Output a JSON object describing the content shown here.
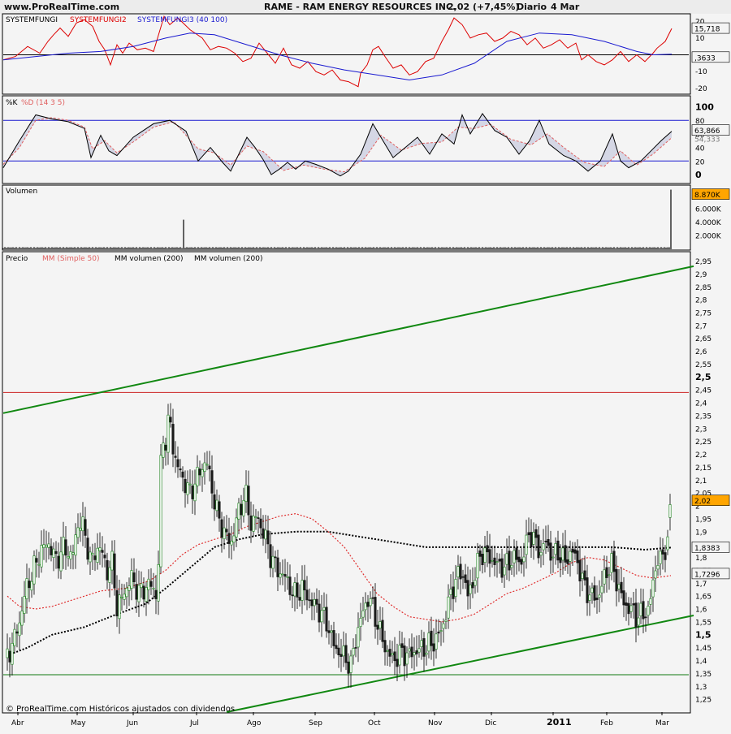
{
  "header": {
    "site": "www.ProRealTime.com",
    "title": "RAME - RAM ENERGY RESOURCES INC.",
    "quote": "2,02 (+7,45%)",
    "period": "Diario",
    "date": "4 Mar"
  },
  "footer": {
    "copyright": "© ProRealTime.com Históricos ajustados con dividendos"
  },
  "colors": {
    "background": "#f4f4f4",
    "price_up": "#2e8b2e",
    "price_down": "#1a1a1a",
    "sma50": "#e03030",
    "vol_ma": "#000000",
    "trendline": "#118811",
    "resistance": "#cc2222",
    "support": "#117711",
    "osc_red": "#dd0000",
    "osc_blue": "#1a1ad0",
    "stoch_k": "#000000",
    "stoch_d": "#e06060",
    "highlight_value": "#ffa500"
  },
  "chart_data": [
    {
      "id": "systemfungi",
      "type": "line",
      "legend": [
        "SYSTEMFUNGI",
        "SYSTEMFUNGI2",
        "SYSTEMFUNGI3 (40 100)"
      ],
      "ylim": [
        -23,
        24
      ],
      "yticks": [
        20,
        10,
        0,
        -10,
        -20
      ],
      "last_values": {
        "red": 15.718,
        "blue": 0.3633
      },
      "last_labels": [
        "15,718",
        ",3633"
      ],
      "zero_label": "0",
      "series": [
        {
          "name": "SYSTEMFUNGI2",
          "color": "#dd0000",
          "x": [
            0,
            15,
            30,
            45,
            55,
            62,
            70,
            80,
            90,
            100,
            110,
            118,
            125,
            132,
            140,
            147,
            155,
            165,
            175,
            185,
            190,
            198,
            205,
            215,
            230,
            245,
            255,
            265,
            275,
            285,
            295,
            305,
            315,
            325,
            335,
            345,
            355,
            365,
            375,
            385,
            395,
            405,
            415,
            425,
            437,
            440,
            448,
            455,
            462,
            470,
            480,
            490,
            500,
            510,
            520,
            530,
            540,
            548,
            555,
            565,
            575,
            585,
            595,
            605,
            615,
            625,
            635,
            645,
            655,
            665,
            675,
            685,
            695,
            705,
            712,
            720,
            730,
            740,
            750,
            760,
            770,
            780,
            790,
            800,
            805,
            815,
            823
          ],
          "y": [
            -3,
            -1,
            5,
            1,
            8,
            12,
            16,
            11,
            19,
            21,
            17,
            8,
            3,
            -6,
            6,
            1,
            7,
            3,
            4,
            2,
            10,
            23,
            18,
            22,
            15,
            10,
            3,
            5,
            4,
            1,
            -4,
            -2,
            7,
            1,
            -5,
            4,
            -6,
            -8,
            -4,
            -10,
            -12,
            -9,
            -15,
            -16,
            -19,
            -11,
            -6,
            3,
            5,
            -1,
            -8,
            -6,
            -12,
            -10,
            -4,
            -2,
            8,
            15,
            22,
            18,
            10,
            12,
            13,
            8,
            10,
            14,
            12,
            6,
            10,
            4,
            6,
            9,
            4,
            7,
            -3,
            0,
            -4,
            -6,
            -3,
            2,
            -4,
            0,
            -4,
            1,
            4,
            8,
            15.718
          ]
        },
        {
          "name": "SYSTEMFUNGI3 (40 100)",
          "color": "#1a1ad0",
          "x": [
            0,
            40,
            80,
            120,
            160,
            200,
            230,
            260,
            300,
            340,
            380,
            420,
            460,
            500,
            540,
            580,
            620,
            660,
            700,
            740,
            780,
            800,
            823
          ],
          "y": [
            -3,
            -1,
            1,
            2,
            5,
            10,
            13,
            12,
            6,
            0,
            -5,
            -9,
            -12,
            -15,
            -12,
            -5,
            8,
            13,
            12,
            8,
            2,
            0,
            0.3633
          ]
        }
      ]
    },
    {
      "id": "stochastic",
      "type": "line",
      "legend": [
        "%K",
        "%D (14 3 5)"
      ],
      "ylim": [
        -12,
        115
      ],
      "yticks": [
        100,
        80,
        60,
        40,
        20,
        0
      ],
      "levels": [
        80,
        20
      ],
      "last_values": {
        "k": 63.866,
        "d": 54.333
      },
      "last_labels": [
        "63,866",
        "54,333"
      ],
      "series": [
        {
          "name": "%K",
          "color": "#000000",
          "x": [
            0,
            20,
            40,
            60,
            80,
            100,
            108,
            120,
            130,
            140,
            160,
            185,
            205,
            225,
            240,
            255,
            270,
            280,
            290,
            300,
            310,
            320,
            330,
            340,
            350,
            360,
            372,
            385,
            400,
            415,
            425,
            440,
            455,
            465,
            480,
            495,
            510,
            525,
            540,
            555,
            565,
            575,
            590,
            605,
            620,
            635,
            648,
            660,
            672,
            690,
            705,
            720,
            735,
            750,
            760,
            770,
            785,
            800,
            810,
            823
          ],
          "y": [
            10,
            50,
            88,
            82,
            78,
            68,
            25,
            58,
            35,
            28,
            55,
            75,
            80,
            64,
            20,
            40,
            18,
            5,
            30,
            55,
            40,
            22,
            0,
            8,
            18,
            8,
            20,
            15,
            8,
            -2,
            5,
            30,
            75,
            55,
            25,
            40,
            55,
            30,
            60,
            45,
            88,
            60,
            90,
            65,
            55,
            30,
            50,
            80,
            45,
            28,
            20,
            5,
            20,
            60,
            20,
            10,
            20,
            38,
            50,
            63.866
          ]
        },
        {
          "name": "%D (14 3 5)",
          "color": "#e06060",
          "x": [
            0,
            20,
            40,
            60,
            80,
            100,
            110,
            125,
            140,
            160,
            185,
            210,
            240,
            260,
            280,
            300,
            320,
            345,
            370,
            395,
            420,
            445,
            465,
            490,
            515,
            540,
            560,
            580,
            600,
            625,
            650,
            670,
            690,
            715,
            740,
            760,
            780,
            800,
            823
          ],
          "y": [
            15,
            40,
            80,
            84,
            80,
            70,
            38,
            50,
            32,
            48,
            70,
            78,
            38,
            32,
            14,
            42,
            34,
            6,
            14,
            8,
            4,
            24,
            58,
            36,
            46,
            48,
            70,
            68,
            74,
            52,
            44,
            60,
            40,
            18,
            12,
            35,
            14,
            30,
            54.333
          ]
        }
      ]
    },
    {
      "id": "volume",
      "type": "bar",
      "legend": [
        "Volumen"
      ],
      "ylim": [
        0,
        9300
      ],
      "yticks": [
        6000,
        4000,
        2000
      ],
      "ytick_labels": [
        "6.000K",
        "4.000K",
        "2.000K"
      ],
      "last_value": 8870,
      "last_label": "8.870K",
      "unit": "K",
      "baseline": 300,
      "spikes": [
        {
          "x": 195,
          "v": 2200
        },
        {
          "x": 197,
          "v": 1100
        },
        {
          "x": 222,
          "v": 4400
        },
        {
          "x": 763,
          "v": 800
        },
        {
          "x": 801,
          "v": 1700
        },
        {
          "x": 822,
          "v": 8870
        }
      ]
    },
    {
      "id": "price",
      "type": "candlestick",
      "legend": [
        "Precio",
        "MM (Simple 50)",
        "MM volumen (200)",
        "MM volumen (200)"
      ],
      "ylim": [
        1.2,
        2.98
      ],
      "yticks": [
        2.95,
        2.9,
        2.85,
        2.8,
        2.75,
        2.7,
        2.65,
        2.6,
        2.55,
        2.5,
        2.45,
        2.4,
        2.35,
        2.3,
        2.25,
        2.2,
        2.15,
        2.1,
        2.05,
        2.0,
        1.95,
        1.9,
        1.85,
        1.8,
        1.75,
        1.7,
        1.65,
        1.6,
        1.55,
        1.5,
        1.45,
        1.4,
        1.35,
        1.3,
        1.25
      ],
      "ytick_labels": [
        "2,95",
        "2,9",
        "2,85",
        "2,8",
        "2,75",
        "2,7",
        "2,65",
        "2,6",
        "2,55",
        "2,5",
        "2,45",
        "2,4",
        "2,35",
        "2,3",
        "2,25",
        "2,2",
        "2,15",
        "2,1",
        "2,05",
        "2",
        "1,95",
        "1,9",
        "1,85",
        "1,8",
        "1,75",
        "1,7",
        "1,65",
        "1,6",
        "1,55",
        "1,5",
        "1,45",
        "1,4",
        "1,35",
        "1,3",
        "1,25"
      ],
      "bold_ticks": [
        "2,5",
        "1,5"
      ],
      "xticks": [
        {
          "x": 18,
          "label": "Abr"
        },
        {
          "x": 91,
          "label": "May"
        },
        {
          "x": 160,
          "label": "Jun"
        },
        {
          "x": 238,
          "label": "Jul"
        },
        {
          "x": 308,
          "label": "Ago"
        },
        {
          "x": 384,
          "label": "Sep"
        },
        {
          "x": 457,
          "label": "Oct"
        },
        {
          "x": 531,
          "label": "Nov"
        },
        {
          "x": 601,
          "label": "Dic"
        },
        {
          "x": 677,
          "label": "2011",
          "bold": true
        },
        {
          "x": 743,
          "label": "Feb"
        },
        {
          "x": 811,
          "label": "Mar"
        }
      ],
      "last_value": 2.02,
      "last_label": "2,02",
      "value_labels": [
        {
          "value": 1.8383,
          "label": "1,8383"
        },
        {
          "value": 1.7296,
          "label": "1,7296"
        }
      ],
      "resistance_level": 2.44,
      "support_level": 1.345,
      "trendlines": [
        {
          "x1": 0,
          "y1": 2.36,
          "x2": 850,
          "y2": 2.93
        },
        {
          "x1": 275,
          "y1": 1.2,
          "x2": 850,
          "y2": 1.575
        }
      ],
      "close_path": {
        "x": [
          5,
          12,
          20,
          28,
          36,
          45,
          55,
          65,
          75,
          85,
          93,
          100,
          108,
          118,
          128,
          135,
          140,
          148,
          158,
          168,
          180,
          190,
          195,
          200,
          205,
          210,
          215,
          222,
          230,
          240,
          250,
          258,
          265,
          272,
          280,
          290,
          298,
          305,
          312,
          320,
          330,
          338,
          348,
          358,
          368,
          378,
          388,
          398,
          408,
          418,
          428,
          435,
          442,
          450,
          460,
          470,
          480,
          490,
          500,
          510,
          520,
          530,
          540,
          548,
          555,
          565,
          572,
          580,
          588,
          598,
          608,
          618,
          628,
          638,
          648,
          656,
          662,
          668,
          676,
          684,
          692,
          700,
          708,
          716,
          724,
          732,
          740,
          748,
          756,
          764,
          772,
          780,
          788,
          795,
          800,
          805,
          810,
          815,
          818,
          820,
          822
        ],
        "y": [
          1.42,
          1.47,
          1.55,
          1.68,
          1.74,
          1.82,
          1.86,
          1.79,
          1.84,
          1.8,
          1.95,
          1.9,
          1.78,
          1.85,
          1.75,
          1.78,
          1.6,
          1.66,
          1.72,
          1.66,
          1.7,
          1.65,
          2.28,
          2.25,
          2.35,
          2.2,
          2.15,
          2.1,
          2.05,
          2.12,
          2.18,
          2.05,
          1.95,
          1.9,
          1.85,
          1.98,
          2.05,
          1.93,
          1.96,
          1.9,
          1.8,
          1.75,
          1.72,
          1.65,
          1.68,
          1.63,
          1.6,
          1.55,
          1.45,
          1.42,
          1.38,
          1.5,
          1.58,
          1.65,
          1.55,
          1.45,
          1.4,
          1.43,
          1.42,
          1.44,
          1.45,
          1.47,
          1.52,
          1.62,
          1.7,
          1.75,
          1.65,
          1.72,
          1.82,
          1.8,
          1.77,
          1.76,
          1.8,
          1.78,
          1.9,
          1.85,
          1.82,
          1.86,
          1.8,
          1.82,
          1.78,
          1.83,
          1.77,
          1.68,
          1.65,
          1.64,
          1.72,
          1.78,
          1.7,
          1.62,
          1.6,
          1.57,
          1.58,
          1.6,
          1.7,
          1.8,
          1.78,
          1.84,
          1.88,
          1.99,
          2.02
        ]
      },
      "volume_ma_path": {
        "x": [
          5,
          30,
          60,
          100,
          140,
          175,
          200,
          230,
          260,
          290,
          320,
          360,
          400,
          440,
          480,
          520,
          550,
          600,
          650,
          700,
          750,
          790,
          822
        ],
        "y": [
          1.42,
          1.45,
          1.5,
          1.53,
          1.58,
          1.62,
          1.68,
          1.76,
          1.84,
          1.87,
          1.89,
          1.9,
          1.9,
          1.88,
          1.86,
          1.84,
          1.84,
          1.84,
          1.84,
          1.84,
          1.84,
          1.83,
          1.8383
        ]
      },
      "sma50_path": {
        "x": [
          5,
          20,
          40,
          60,
          80,
          100,
          120,
          150,
          180,
          200,
          220,
          240,
          260,
          280,
          300,
          320,
          340,
          360,
          380,
          400,
          420,
          440,
          460,
          480,
          500,
          520,
          540,
          560,
          580,
          600,
          620,
          640,
          660,
          680,
          700,
          720,
          740,
          760,
          780,
          800,
          822
        ],
        "y": [
          1.65,
          1.61,
          1.6,
          1.61,
          1.63,
          1.65,
          1.67,
          1.68,
          1.71,
          1.75,
          1.81,
          1.85,
          1.87,
          1.89,
          1.92,
          1.94,
          1.96,
          1.97,
          1.95,
          1.9,
          1.84,
          1.75,
          1.66,
          1.61,
          1.57,
          1.56,
          1.55,
          1.56,
          1.58,
          1.62,
          1.66,
          1.68,
          1.71,
          1.74,
          1.78,
          1.8,
          1.79,
          1.76,
          1.73,
          1.72,
          1.7296
        ]
      }
    }
  ]
}
